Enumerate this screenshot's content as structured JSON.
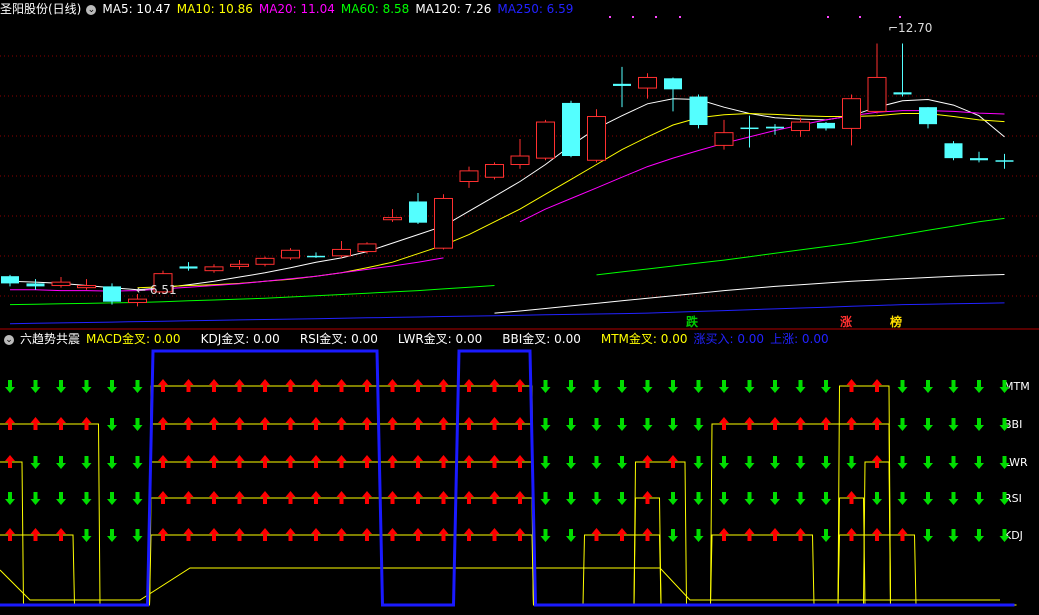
{
  "top_panel": {
    "title": "圣阳股份(日线)",
    "collapse_icon": "chevron-down-icon",
    "ma_labels": [
      {
        "text": "MA5: 10.47",
        "color": "#ffffff"
      },
      {
        "text": "MA10: 10.86",
        "color": "#ffff00"
      },
      {
        "text": "MA20: 11.04",
        "color": "#ff00ff"
      },
      {
        "text": "MA60: 8.58",
        "color": "#00ff00"
      },
      {
        "text": "MA120: 7.26",
        "color": "#ffffff"
      },
      {
        "text": "MA250: 6.59",
        "color": "#2222ff"
      }
    ],
    "high_marker": "12.70",
    "low_marker": "6.51",
    "signals": [
      {
        "text": "跌",
        "color": "#00cc00"
      },
      {
        "text": "涨",
        "color": "#ff3030"
      },
      {
        "text": "榜",
        "color": "#ffdd00"
      }
    ]
  },
  "bottom_panel": {
    "title": "六趋势共震",
    "collapse_icon": "chevron-down-icon",
    "labels": [
      {
        "text": "MACD金叉: 0.00",
        "color": "#ffff00"
      },
      {
        "text": "KDJ金叉: 0.00",
        "color": "#ffffff"
      },
      {
        "text": "RSI金叉: 0.00",
        "color": "#ffffff"
      },
      {
        "text": "LWR金叉: 0.00",
        "color": "#ffffff"
      },
      {
        "text": "BBI金叉: 0.00",
        "color": "#ffffff"
      },
      {
        "text": "MTM金叉: 0.00",
        "color": "#ffff00"
      },
      {
        "text": "涨买入: 0.00",
        "color": "#2222ff"
      },
      {
        "text": "上涨: 0.00",
        "color": "#2222ff"
      }
    ],
    "indicator_labels": [
      "MTM",
      "BBI",
      "LWR",
      "RSI",
      "KDJ"
    ]
  },
  "colors": {
    "up": "#ff3030",
    "down": "#54ffff",
    "grid": "#8b0000",
    "arrow_up": "#ff0000",
    "arrow_down": "#00dd00"
  },
  "chart_data": [
    {
      "type": "candlestick",
      "title": "圣阳股份(日线)",
      "ylim": [
        6.0,
        13.3
      ],
      "candles": [
        {
          "o": 7.22,
          "h": 7.25,
          "c": 7.05,
          "l": 6.98
        },
        {
          "o": 7.05,
          "h": 7.15,
          "c": 6.98,
          "l": 6.9
        },
        {
          "o": 7.0,
          "h": 7.2,
          "c": 7.08,
          "l": 6.95
        },
        {
          "o": 6.95,
          "h": 7.15,
          "c": 7.0,
          "l": 6.9
        },
        {
          "o": 6.98,
          "h": 7.05,
          "c": 6.62,
          "l": 6.55
        },
        {
          "o": 6.6,
          "h": 6.8,
          "c": 6.68,
          "l": 6.51
        },
        {
          "o": 6.85,
          "h": 7.35,
          "c": 7.28,
          "l": 6.8
        },
        {
          "o": 7.45,
          "h": 7.55,
          "c": 7.4,
          "l": 7.35
        },
        {
          "o": 7.35,
          "h": 7.5,
          "c": 7.44,
          "l": 7.3
        },
        {
          "o": 7.45,
          "h": 7.6,
          "c": 7.5,
          "l": 7.38
        },
        {
          "o": 7.5,
          "h": 7.68,
          "c": 7.64,
          "l": 7.45
        },
        {
          "o": 7.65,
          "h": 7.88,
          "c": 7.83,
          "l": 7.6
        },
        {
          "o": 7.7,
          "h": 7.78,
          "c": 7.68,
          "l": 7.65
        },
        {
          "o": 7.7,
          "h": 8.05,
          "c": 7.85,
          "l": 7.65
        },
        {
          "o": 7.8,
          "h": 8.02,
          "c": 7.98,
          "l": 7.75
        },
        {
          "o": 8.55,
          "h": 8.8,
          "c": 8.6,
          "l": 8.5
        },
        {
          "o": 8.98,
          "h": 9.18,
          "c": 8.48,
          "l": 8.45
        },
        {
          "o": 7.88,
          "h": 9.15,
          "c": 9.05,
          "l": 7.85
        },
        {
          "o": 9.45,
          "h": 9.8,
          "c": 9.7,
          "l": 9.3
        },
        {
          "o": 9.55,
          "h": 9.9,
          "c": 9.85,
          "l": 9.5
        },
        {
          "o": 9.85,
          "h": 10.45,
          "c": 10.05,
          "l": 9.75
        },
        {
          "o": 10.0,
          "h": 10.9,
          "c": 10.85,
          "l": 9.95
        },
        {
          "o": 11.3,
          "h": 11.35,
          "c": 10.05,
          "l": 10.02
        },
        {
          "o": 9.95,
          "h": 11.15,
          "c": 10.98,
          "l": 9.9
        },
        {
          "o": 11.75,
          "h": 12.15,
          "c": 11.7,
          "l": 11.2
        },
        {
          "o": 11.65,
          "h": 12.0,
          "c": 11.9,
          "l": 11.4
        },
        {
          "o": 11.88,
          "h": 11.9,
          "c": 11.62,
          "l": 11.1
        },
        {
          "o": 11.45,
          "h": 11.5,
          "c": 10.78,
          "l": 10.7
        },
        {
          "o": 10.3,
          "h": 10.9,
          "c": 10.6,
          "l": 10.2
        },
        {
          "o": 10.72,
          "h": 11.0,
          "c": 10.7,
          "l": 10.25
        },
        {
          "o": 10.74,
          "h": 10.8,
          "c": 10.7,
          "l": 10.55
        },
        {
          "o": 10.65,
          "h": 10.95,
          "c": 10.85,
          "l": 10.5
        },
        {
          "o": 10.83,
          "h": 10.85,
          "c": 10.7,
          "l": 10.65
        },
        {
          "o": 10.7,
          "h": 11.5,
          "c": 11.4,
          "l": 10.3
        },
        {
          "o": 11.1,
          "h": 12.7,
          "c": 11.9,
          "l": 11.05
        },
        {
          "o": 11.55,
          "h": 12.7,
          "c": 11.5,
          "l": 11.45
        },
        {
          "o": 11.2,
          "h": 11.2,
          "c": 10.8,
          "l": 10.7
        },
        {
          "o": 10.35,
          "h": 10.4,
          "c": 10.0,
          "l": 9.95
        },
        {
          "o": 10.0,
          "h": 10.15,
          "c": 9.95,
          "l": 9.9
        },
        {
          "o": 9.95,
          "h": 10.1,
          "c": 9.92,
          "l": 9.75
        }
      ],
      "series": [
        {
          "name": "MA5",
          "values": [
            7.1,
            7.08,
            7.05,
            7.0,
            6.95,
            6.9,
            6.95,
            7.02,
            7.1,
            7.2,
            7.3,
            7.42,
            7.55,
            7.65,
            7.8,
            8.0,
            8.2,
            8.4,
            8.75,
            9.1,
            9.45,
            9.85,
            10.3,
            10.7,
            11.0,
            11.28,
            11.4,
            11.38,
            11.2,
            11.05,
            10.95,
            10.92,
            10.9,
            11.0,
            11.2,
            11.35,
            11.38,
            11.25,
            11.0,
            10.5
          ]
        },
        {
          "name": "MA10",
          "values": [
            null,
            null,
            null,
            null,
            null,
            6.95,
            6.97,
            7.0,
            7.02,
            7.05,
            7.1,
            7.15,
            7.22,
            7.3,
            7.42,
            7.55,
            7.75,
            7.95,
            8.2,
            8.5,
            8.8,
            9.15,
            9.5,
            9.85,
            10.2,
            10.5,
            10.78,
            10.95,
            11.02,
            11.05,
            11.03,
            11.0,
            10.98,
            10.98,
            11.0,
            11.05,
            11.05,
            10.98,
            10.9,
            10.86
          ]
        },
        {
          "name": "MA20",
          "values": [
            6.9,
            6.9,
            6.88,
            6.88,
            6.87,
            6.88,
            6.92,
            6.96,
            7.0,
            7.04,
            7.1,
            7.16,
            7.22,
            7.3,
            7.38,
            7.46,
            7.55,
            7.65,
            null,
            null,
            8.5,
            8.8,
            9.05,
            9.3,
            9.55,
            9.8,
            10.0,
            10.18,
            10.35,
            10.5,
            10.65,
            10.78,
            10.9,
            11.0,
            11.08,
            11.12,
            11.12,
            11.1,
            11.06,
            11.04
          ]
        },
        {
          "name": "MA60",
          "values": [
            6.55,
            6.56,
            6.57,
            6.58,
            6.59,
            6.6,
            6.62,
            6.64,
            6.66,
            6.68,
            6.7,
            6.73,
            6.76,
            6.79,
            6.82,
            6.85,
            6.88,
            6.92,
            6.96,
            7.0,
            null,
            null,
            null,
            7.25,
            7.32,
            7.39,
            7.46,
            7.53,
            7.6,
            7.68,
            7.76,
            7.84,
            7.92,
            8.0,
            8.1,
            8.2,
            8.3,
            8.4,
            8.5,
            8.58
          ]
        },
        {
          "name": "MA120",
          "values": [
            null,
            null,
            null,
            null,
            null,
            null,
            null,
            null,
            null,
            null,
            null,
            null,
            null,
            null,
            null,
            null,
            null,
            null,
            null,
            6.35,
            6.4,
            6.46,
            6.52,
            6.58,
            6.64,
            6.7,
            6.76,
            6.82,
            6.88,
            6.93,
            6.98,
            7.02,
            7.06,
            7.1,
            7.13,
            7.16,
            7.19,
            7.22,
            7.24,
            7.26
          ]
        },
        {
          "name": "MA250",
          "values": [
            6.1,
            6.11,
            6.12,
            6.13,
            6.14,
            6.15,
            6.16,
            6.17,
            6.18,
            6.19,
            6.2,
            6.21,
            6.22,
            6.23,
            6.24,
            6.25,
            6.26,
            6.27,
            6.28,
            6.29,
            6.3,
            6.31,
            6.32,
            6.33,
            6.34,
            6.35,
            6.37,
            6.39,
            6.41,
            6.43,
            6.45,
            6.47,
            6.49,
            6.51,
            6.53,
            6.55,
            6.56,
            6.57,
            6.58,
            6.59
          ]
        }
      ]
    },
    {
      "type": "line",
      "title": "六趋势共震",
      "y_levels": [
        "MTM",
        "BBI",
        "LWR",
        "RSI",
        "KDJ"
      ],
      "arrows": {
        "MTM": [
          0,
          0,
          0,
          0,
          0,
          0,
          1,
          1,
          1,
          1,
          1,
          1,
          1,
          1,
          1,
          1,
          1,
          1,
          1,
          1,
          1,
          0,
          0,
          0,
          0,
          0,
          0,
          0,
          0,
          0,
          0,
          0,
          0,
          1,
          1,
          0,
          0,
          0,
          0,
          0
        ],
        "BBI": [
          1,
          1,
          1,
          1,
          0,
          0,
          1,
          1,
          1,
          1,
          1,
          1,
          1,
          1,
          1,
          1,
          1,
          1,
          1,
          1,
          1,
          0,
          0,
          0,
          0,
          0,
          0,
          0,
          1,
          1,
          1,
          1,
          1,
          1,
          1,
          0,
          0,
          0,
          0,
          0
        ],
        "LWR": [
          1,
          0,
          0,
          0,
          0,
          0,
          1,
          1,
          1,
          1,
          1,
          1,
          1,
          1,
          1,
          1,
          1,
          1,
          1,
          1,
          1,
          0,
          0,
          0,
          0,
          1,
          1,
          0,
          0,
          0,
          0,
          0,
          0,
          0,
          1,
          0,
          0,
          0,
          0,
          0
        ],
        "RSI": [
          0,
          0,
          0,
          0,
          0,
          0,
          1,
          1,
          1,
          1,
          1,
          1,
          1,
          1,
          1,
          1,
          1,
          1,
          1,
          1,
          1,
          0,
          0,
          0,
          0,
          1,
          0,
          0,
          0,
          0,
          0,
          0,
          0,
          1,
          0,
          0,
          0,
          0,
          0,
          0
        ],
        "KDJ": [
          1,
          1,
          1,
          0,
          0,
          0,
          1,
          1,
          1,
          1,
          1,
          1,
          1,
          1,
          1,
          1,
          1,
          1,
          1,
          1,
          1,
          0,
          0,
          1,
          1,
          1,
          0,
          0,
          1,
          1,
          1,
          1,
          0,
          1,
          1,
          1,
          0,
          0,
          0,
          0
        ]
      },
      "series": [
        {
          "name": "上涨",
          "values": [
            0,
            0,
            0,
            0,
            0,
            0,
            1,
            1,
            1,
            1,
            1,
            1,
            1,
            1,
            1,
            0,
            0,
            0,
            1,
            1,
            1,
            0,
            0,
            0,
            0,
            0,
            0,
            0,
            0,
            0,
            0,
            0,
            0,
            0,
            0,
            0,
            0,
            0,
            0,
            0
          ]
        }
      ]
    }
  ]
}
